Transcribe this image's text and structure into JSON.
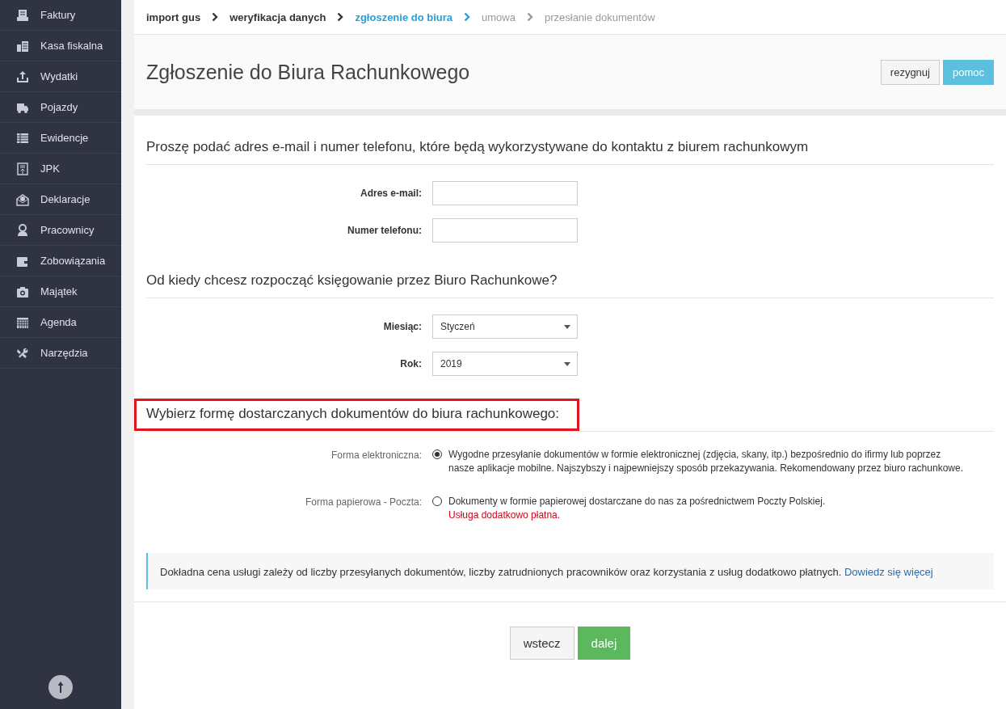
{
  "sidebar": {
    "items": [
      {
        "label": "Faktury"
      },
      {
        "label": "Kasa fiskalna"
      },
      {
        "label": "Wydatki"
      },
      {
        "label": "Pojazdy"
      },
      {
        "label": "Ewidencje"
      },
      {
        "label": "JPK"
      },
      {
        "label": "Deklaracje"
      },
      {
        "label": "Pracownicy"
      },
      {
        "label": "Zobowiązania"
      },
      {
        "label": "Majątek"
      },
      {
        "label": "Agenda"
      },
      {
        "label": "Narzędzia"
      }
    ]
  },
  "steps": [
    {
      "label": "import gus",
      "completed": true,
      "selected": false
    },
    {
      "label": "weryfikacja danych",
      "completed": true,
      "selected": false
    },
    {
      "label": "zgłoszenie do biura",
      "completed": false,
      "selected": true
    },
    {
      "label": "umowa",
      "completed": false,
      "selected": false
    },
    {
      "label": "przesłanie dokumentów",
      "completed": false,
      "selected": false
    }
  ],
  "page_title": "Zgłoszenie do Biura Rachunkowego",
  "header_buttons": [
    {
      "label": "rezygnuj",
      "kind": "default"
    },
    {
      "label": "pomoc",
      "kind": "info"
    }
  ],
  "sections": [
    {
      "heading": "Proszę podać adres e-mail i numer telefonu, które będą wykorzystywane do kontaktu z biurem rachunkowym",
      "highlighted": false,
      "fields": [
        {
          "kind": "input",
          "label": "Adres e-mail:"
        },
        {
          "kind": "input",
          "label": "Numer telefonu:"
        }
      ]
    },
    {
      "heading": "Od kiedy chcesz rozpocząć księgowanie przez Biuro Rachunkowe?",
      "highlighted": false,
      "fields": [
        {
          "kind": "select",
          "label": "Miesiąc:",
          "value": "Styczeń"
        },
        {
          "kind": "select",
          "label": "Rok:",
          "value": "2019"
        }
      ]
    },
    {
      "heading": "Wybierz formę dostarczanych dokumentów do biura rachunkowego:",
      "highlighted": true,
      "fields": [
        {
          "kind": "radio",
          "label": "Forma elektroniczna:",
          "selected": true,
          "text": "Wygodne przesyłanie dokumentów w formie elektronicznej (zdjęcia, skany, itp.) bezpośrednio do ifirmy lub poprzez nasze aplikacje mobilne. Najszybszy i najpewniejszy sposób przekazywania. Rekomendowany przez biuro rachunkowe."
        },
        {
          "kind": "radio",
          "label": "Forma papierowa - Poczta:",
          "selected": false,
          "text": "Dokumenty w formie papierowej dostarczane do nas za pośrednictwem Poczty Polskiej.",
          "note": "Usługa dodatkowo płatna."
        }
      ]
    }
  ],
  "info": {
    "text": "Dokładna cena usługi zależy od liczby przesyłanych dokumentów, liczby zatrudnionych pracowników oraz korzystania z usług dodatkowo płatnych.",
    "link": "Dowiedz się więcej"
  },
  "footer_buttons": [
    {
      "label": "wstecz",
      "kind": "default"
    },
    {
      "label": "dalej",
      "kind": "success"
    }
  ]
}
